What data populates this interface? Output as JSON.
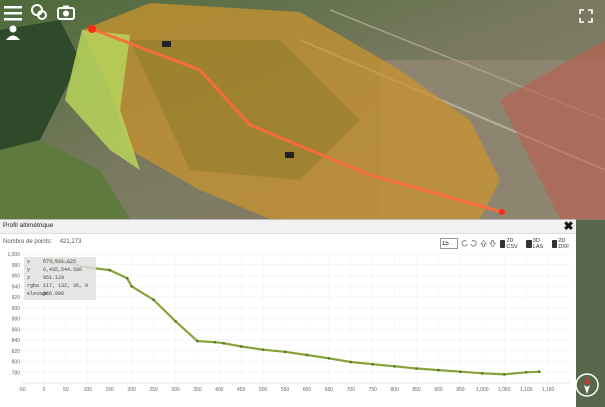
{
  "toolbar": {
    "menu_icon": "hamburger-menu-icon",
    "layers_icon": "layers-icon",
    "camera_icon": "camera-icon",
    "user_icon": "user-location-icon",
    "expand_icon": "expand-icon"
  },
  "profile_panel": {
    "title": "Profil altimétrique",
    "points_label": "Nombre de points:",
    "points_count": "421,273",
    "density_value": "15",
    "exports": [
      {
        "label": "2D CSV"
      },
      {
        "label": "3D LAS"
      },
      {
        "label": "2D DXF"
      }
    ],
    "info": [
      {
        "key": "x",
        "value": "673,531.625"
      },
      {
        "key": "y",
        "value": "6,435,544.586"
      },
      {
        "key": "z",
        "value": "951.129"
      },
      {
        "key": "rgba",
        "value": "117, 132, 36, 0"
      },
      {
        "key": "elevage",
        "value": "966.996"
      }
    ]
  },
  "colors": {
    "terrain_green": "#8aa23a",
    "map_marker_red": "#ff2a1a",
    "overlay_orange": "#d88a3c"
  },
  "chart_data": {
    "type": "scatter",
    "title": "",
    "xlabel": "",
    "ylabel": "",
    "xlim": [
      -50,
      1200
    ],
    "ylim": [
      760,
      1000
    ],
    "x_ticks": [
      -50,
      0,
      50,
      100,
      150,
      200,
      250,
      300,
      350,
      400,
      450,
      500,
      550,
      600,
      650,
      700,
      750,
      800,
      850,
      900,
      950,
      1000,
      1050,
      1100,
      1150
    ],
    "y_ticks": [
      1000,
      980,
      960,
      940,
      920,
      900,
      880,
      860,
      840,
      820,
      800,
      780
    ],
    "series": [
      {
        "x": [
          0,
          50,
          100,
          150,
          190,
          200,
          250,
          300,
          350,
          390,
          410,
          450,
          500,
          550,
          600,
          650,
          700,
          750,
          800,
          850,
          900,
          950,
          1000,
          1050,
          1100,
          1130
        ],
        "y": [
          990,
          985,
          975,
          970,
          955,
          940,
          915,
          875,
          838,
          836,
          834,
          828,
          822,
          818,
          812,
          806,
          799,
          795,
          791,
          787,
          784,
          781,
          778,
          776,
          780,
          781
        ]
      }
    ]
  }
}
